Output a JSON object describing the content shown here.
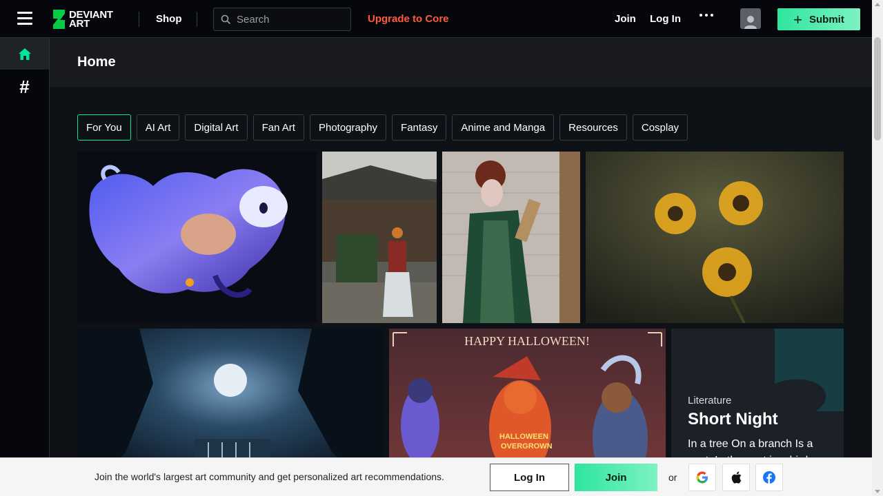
{
  "header": {
    "logo_line1": "DEVIANT",
    "logo_line2": "ART",
    "shop": "Shop",
    "search_placeholder": "Search",
    "upgrade": "Upgrade to Core",
    "join": "Join",
    "login": "Log In",
    "submit": "Submit"
  },
  "sidebar": {
    "items": [
      {
        "name": "home",
        "icon": "home-icon"
      },
      {
        "name": "topics",
        "icon": "hash-icon",
        "glyph": "#"
      }
    ]
  },
  "page": {
    "title": "Home"
  },
  "tabs": [
    {
      "label": "For You",
      "active": true
    },
    {
      "label": "AI Art"
    },
    {
      "label": "Digital Art"
    },
    {
      "label": "Fan Art"
    },
    {
      "label": "Photography"
    },
    {
      "label": "Fantasy"
    },
    {
      "label": "Anime and Manga"
    },
    {
      "label": "Resources"
    },
    {
      "label": "Cosplay"
    }
  ],
  "gallery": {
    "halloween_heading": "HAPPY HALLOWEEN!",
    "halloween_labels": [
      "HALLOWEEN",
      "OVERGROWN"
    ]
  },
  "literature": {
    "category": "Literature",
    "title": "Short Night",
    "excerpt": "In a tree On a branch Is a nest, In the nest is a bird ... the bran..."
  },
  "banner": {
    "text": "Join the world's largest art community and get personalized art recommendations.",
    "login": "Log In",
    "join": "Join",
    "or": "or",
    "social": [
      "google-icon",
      "apple-icon",
      "facebook-icon"
    ]
  },
  "colors": {
    "accent_green": "#00e59b",
    "upgrade_orange": "#ff5b3a",
    "background": "#0e1115"
  }
}
